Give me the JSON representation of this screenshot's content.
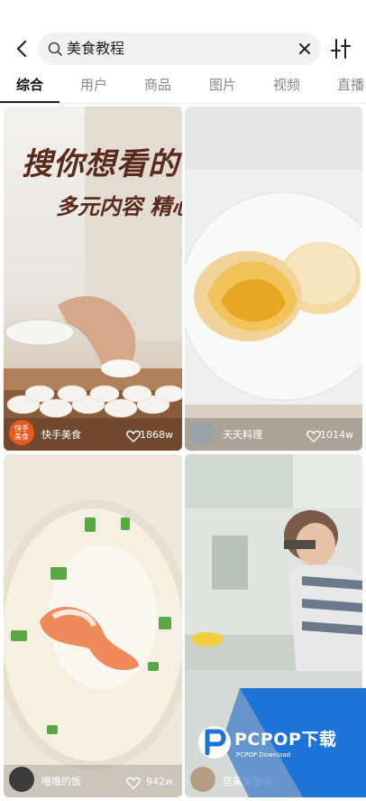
{
  "search": {
    "query": "美食教程"
  },
  "tabs": [
    {
      "label": "综合"
    },
    {
      "label": "用户"
    },
    {
      "label": "商品"
    },
    {
      "label": "图片"
    },
    {
      "label": "视频"
    },
    {
      "label": "直播"
    }
  ],
  "cards": [
    {
      "overlay_line1": "搜你想看的",
      "overlay_line2": "多元内容 精心挑选",
      "badge": "快手\n美食",
      "author": "快手美食",
      "likes": "1868w"
    },
    {
      "author": "天天料理",
      "likes": "1014w"
    },
    {
      "author": "噜噜的饭",
      "likes": "942w"
    },
    {
      "author": "坚果爱做饭",
      "likes": ""
    }
  ],
  "watermark": {
    "brand": "PCPOP下载",
    "sub": "PCPOP Download"
  },
  "colors": {
    "accent": "#1e73d8",
    "badge": "#e85a1f",
    "text": "#222222",
    "muted": "#888888"
  }
}
